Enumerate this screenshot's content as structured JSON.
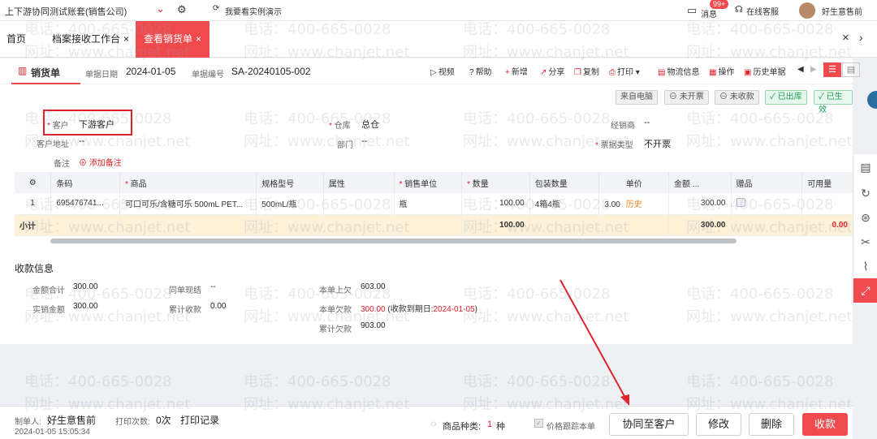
{
  "topbar": {
    "company": "上下游协同测试账套(销售公司)",
    "demo": "我要看实例演示",
    "messages": "消息",
    "msg_count": "99+",
    "service": "在线客服",
    "user": "好生意售前"
  },
  "tabs": [
    {
      "label": "首页"
    },
    {
      "label": "档案接收工作台"
    },
    {
      "label": "查看销货单"
    }
  ],
  "doc": {
    "title": "销货单",
    "date_label": "单据日期",
    "date": "2024-01-05",
    "no_label": "单据编号",
    "no": "SA-20240105-002"
  },
  "toolbar": {
    "video": "视频",
    "help": "帮助",
    "add": "新增",
    "share": "分享",
    "copy": "复制",
    "print": "打印",
    "logistics": "物流信息",
    "ops": "操作",
    "history": "历史单据"
  },
  "badges": [
    "来自电脑",
    "未开票",
    "未收款",
    "已出库",
    "已生效"
  ],
  "form": {
    "customer_label": "客户",
    "customer": "下游客户",
    "warehouse_label": "仓库",
    "warehouse": "总仓",
    "dealer_label": "经销商",
    "dealer": "--",
    "address_label": "客户地址",
    "address": "--",
    "dept_label": "部门",
    "dept": "--",
    "invoice_label": "票据类型",
    "invoice": "不开票",
    "remark_label": "备注",
    "add_remark": "添加备注"
  },
  "grid": {
    "headers": [
      "条码",
      "商品",
      "规格型号",
      "属性",
      "销售单位",
      "数量",
      "包装数量",
      "单价",
      "金额 ...",
      "赠品",
      "可用量"
    ],
    "row": {
      "idx": "1",
      "barcode": "695476741...",
      "product": "可口可乐/含糖可乐 500mL PET...",
      "spec": "500mL/瓶",
      "attr": "",
      "unit": "瓶",
      "qty": "100.00",
      "pack": "4箱4瓶",
      "price": "3.00",
      "history": "历史",
      "amount": "300.00",
      "avail": ""
    },
    "subtotal": {
      "label": "小计",
      "qty": "100.00",
      "amount": "300.00",
      "avail": "0.00"
    }
  },
  "payment": {
    "section": "收款信息",
    "total_label": "金额合计",
    "total": "300.00",
    "actual_label": "实销金额",
    "actual": "300.00",
    "cash_label": "同单现结",
    "cash": "--",
    "acc_label": "累计收款",
    "acc": "0.00",
    "prev_label": "本单上欠",
    "prev": "603.00",
    "owe_label": "本单欠款",
    "owe": "300.00",
    "due_pre": "(收款到期日:",
    "due": "2024-01-05",
    "due_post": ")",
    "total_owe_label": "累计欠款",
    "total_owe": "903.00"
  },
  "footer": {
    "maker_label": "制单人:",
    "maker": "好生意售前",
    "time": "2024-01-05 15:05:34",
    "print_label": "打印次数:",
    "print_count": "0次",
    "print_record": "打印记录",
    "kinds_label": "商品种类:",
    "kinds": "1",
    "kinds_unit": "种",
    "track": "价格跟踪本单",
    "sync": "协同至客户",
    "edit": "修改",
    "delete": "删除",
    "collect": "收款"
  },
  "watermark": {
    "phone": "电话：400-665-0028",
    "site": "网址：www.chanjet.net"
  },
  "colors": {
    "accent": "#ef4b4f",
    "annotation": "#e0202a"
  }
}
